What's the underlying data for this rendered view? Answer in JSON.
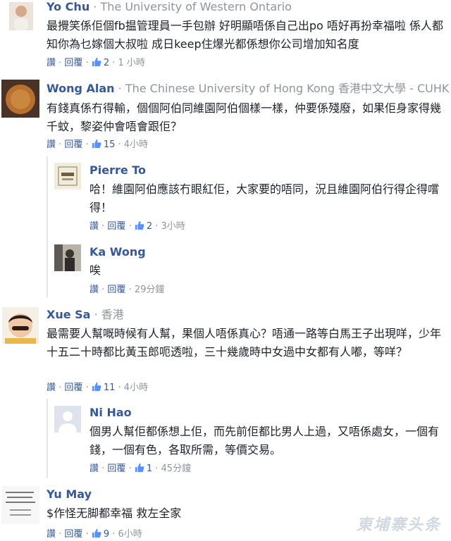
{
  "comments": [
    {
      "name": "Yo Chu",
      "sep": "·",
      "aff": "The University of Western Ontario",
      "text": "最攪笑係佢個fb揾管理員一手包辦 好明顯唔係自己出po 唔好再扮幸福啦 係人都知你為乜嫁個大叔啦 成日keep住爆光都係想你公司增加知名度",
      "reply": "讚",
      "reply2": "回覆",
      "likes": "2",
      "time": "1 小時"
    },
    {
      "name": "Wong Alan",
      "sep": "·",
      "aff": "The Chinese University of Hong Kong 香港中文大學 - CUHK",
      "text": "有錢真係冇得輸，個個阿伯同維園阿伯個樣一樣，仲要係殘廢，如果佢身家得幾千蚊，黎姿仲會唔會跟佢？",
      "reply": "讚",
      "reply2": "回覆",
      "likes": "15",
      "time": "4小時"
    },
    {
      "name": "Pierre To",
      "sep": "",
      "aff": "",
      "text": "哈！維園阿伯應該冇眼紅佢，大家要的唔同，況且維園阿伯行得企得嚐得！",
      "reply": "讚",
      "reply2": "回覆",
      "likes": "2",
      "time": "3小時"
    },
    {
      "name": "Ka Wong",
      "sep": "",
      "aff": "",
      "text": "唉",
      "reply": "讚",
      "reply2": "回覆",
      "likes": "",
      "time": "29分鐘"
    },
    {
      "name": "Xue Sa",
      "sep": "·",
      "aff": "香港",
      "text": "最需要人幫嘅時候有人幫，果個人唔係真心？唔通一路等白馬王子出現咩，少年十五二十時都比黃玉郎呃透啦，三十幾歲時中女過中女都有人嘟，等咩？",
      "reply": "讚",
      "reply2": "回覆",
      "likes": "11",
      "time": "4小時"
    },
    {
      "name": "Ni Hao",
      "sep": "",
      "aff": "",
      "text": "個男人幫佢都係想上佢，而先前佢都比男人上過，又唔係處女，一個有錢，一個有色，各取所需，等價交易。",
      "reply": "讚",
      "reply2": "回覆",
      "likes": "1",
      "time": "45分鐘"
    },
    {
      "name": "Yu May",
      "sep": "",
      "aff": "",
      "text": "$作怪无脚都幸福 救左全家",
      "reply": "讚",
      "reply2": "回覆",
      "likes": "9",
      "time": "6小時"
    }
  ],
  "watermark": "東埔寨头条",
  "colors": {
    "link": "#365899",
    "meta": "#90949c",
    "text": "#1d2129"
  }
}
